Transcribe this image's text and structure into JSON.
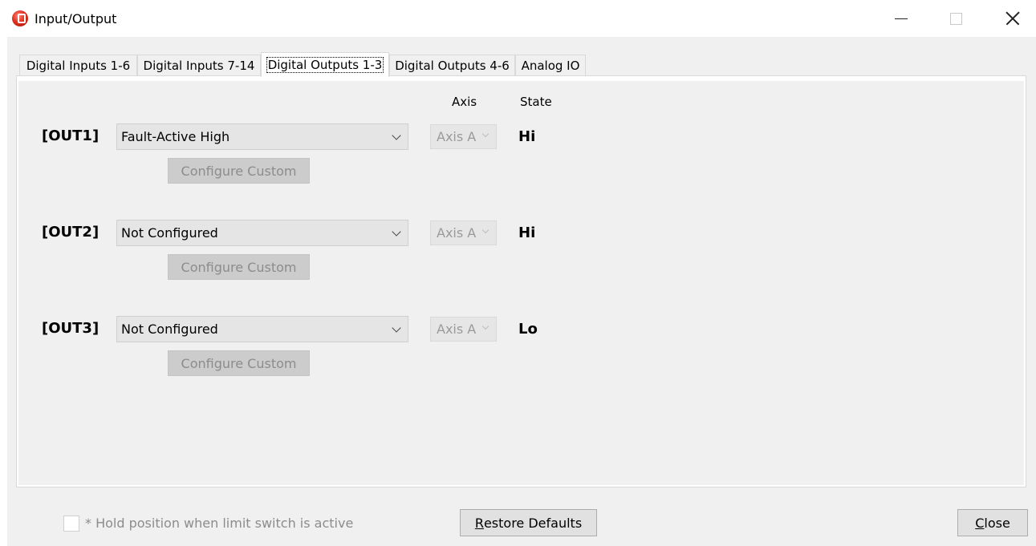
{
  "window": {
    "title": "Input/Output",
    "icon": "app-logo-icon"
  },
  "tabs": [
    {
      "label": "Digital Inputs  1-6",
      "active": false
    },
    {
      "label": "Digital Inputs 7-14",
      "active": false
    },
    {
      "label": "Digital Outputs 1-3",
      "active": true
    },
    {
      "label": "Digital Outputs 4-6",
      "active": false
    },
    {
      "label": "Analog IO",
      "active": false
    }
  ],
  "columns": {
    "axis": "Axis",
    "state": "State"
  },
  "outputs": [
    {
      "label": "[OUT1]",
      "function": "Fault-Active High",
      "axis": "Axis A",
      "state": "Hi",
      "configure_label": "Configure Custom"
    },
    {
      "label": "[OUT2]",
      "function": "Not Configured",
      "axis": "Axis A",
      "state": "Hi",
      "configure_label": "Configure Custom"
    },
    {
      "label": "[OUT3]",
      "function": "Not Configured",
      "axis": "Axis A",
      "state": "Lo",
      "configure_label": "Configure Custom"
    }
  ],
  "footer": {
    "hold_checkbox_label": "* Hold position when limit switch is active",
    "hold_checked": false,
    "restore_first": "R",
    "restore_rest": "estore Defaults",
    "close_first": "C",
    "close_rest": "lose"
  },
  "colors": {
    "window_bg": "#f0f0f0",
    "disabled_text": "#8c8c8c"
  }
}
